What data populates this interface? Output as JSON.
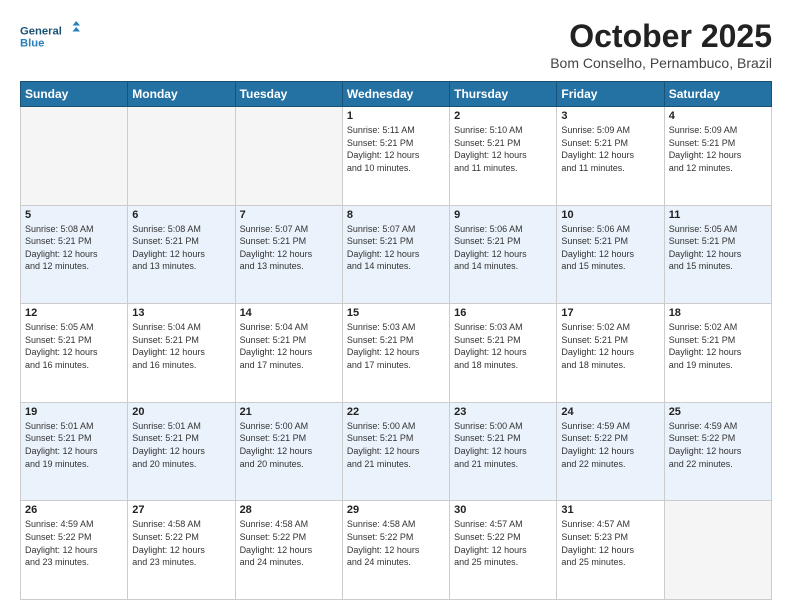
{
  "header": {
    "logo_line1": "General",
    "logo_line2": "Blue",
    "month": "October 2025",
    "location": "Bom Conselho, Pernambuco, Brazil"
  },
  "days_of_week": [
    "Sunday",
    "Monday",
    "Tuesday",
    "Wednesday",
    "Thursday",
    "Friday",
    "Saturday"
  ],
  "weeks": [
    [
      {
        "day": "",
        "empty": true
      },
      {
        "day": "",
        "empty": true
      },
      {
        "day": "",
        "empty": true
      },
      {
        "day": "1",
        "sunrise": "5:11 AM",
        "sunset": "5:21 PM",
        "daylight": "12 hours and 10 minutes."
      },
      {
        "day": "2",
        "sunrise": "5:10 AM",
        "sunset": "5:21 PM",
        "daylight": "12 hours and 11 minutes."
      },
      {
        "day": "3",
        "sunrise": "5:09 AM",
        "sunset": "5:21 PM",
        "daylight": "12 hours and 11 minutes."
      },
      {
        "day": "4",
        "sunrise": "5:09 AM",
        "sunset": "5:21 PM",
        "daylight": "12 hours and 12 minutes."
      }
    ],
    [
      {
        "day": "5",
        "sunrise": "5:08 AM",
        "sunset": "5:21 PM",
        "daylight": "12 hours and 12 minutes."
      },
      {
        "day": "6",
        "sunrise": "5:08 AM",
        "sunset": "5:21 PM",
        "daylight": "12 hours and 13 minutes."
      },
      {
        "day": "7",
        "sunrise": "5:07 AM",
        "sunset": "5:21 PM",
        "daylight": "12 hours and 13 minutes."
      },
      {
        "day": "8",
        "sunrise": "5:07 AM",
        "sunset": "5:21 PM",
        "daylight": "12 hours and 14 minutes."
      },
      {
        "day": "9",
        "sunrise": "5:06 AM",
        "sunset": "5:21 PM",
        "daylight": "12 hours and 14 minutes."
      },
      {
        "day": "10",
        "sunrise": "5:06 AM",
        "sunset": "5:21 PM",
        "daylight": "12 hours and 15 minutes."
      },
      {
        "day": "11",
        "sunrise": "5:05 AM",
        "sunset": "5:21 PM",
        "daylight": "12 hours and 15 minutes."
      }
    ],
    [
      {
        "day": "12",
        "sunrise": "5:05 AM",
        "sunset": "5:21 PM",
        "daylight": "12 hours and 16 minutes."
      },
      {
        "day": "13",
        "sunrise": "5:04 AM",
        "sunset": "5:21 PM",
        "daylight": "12 hours and 16 minutes."
      },
      {
        "day": "14",
        "sunrise": "5:04 AM",
        "sunset": "5:21 PM",
        "daylight": "12 hours and 17 minutes."
      },
      {
        "day": "15",
        "sunrise": "5:03 AM",
        "sunset": "5:21 PM",
        "daylight": "12 hours and 17 minutes."
      },
      {
        "day": "16",
        "sunrise": "5:03 AM",
        "sunset": "5:21 PM",
        "daylight": "12 hours and 18 minutes."
      },
      {
        "day": "17",
        "sunrise": "5:02 AM",
        "sunset": "5:21 PM",
        "daylight": "12 hours and 18 minutes."
      },
      {
        "day": "18",
        "sunrise": "5:02 AM",
        "sunset": "5:21 PM",
        "daylight": "12 hours and 19 minutes."
      }
    ],
    [
      {
        "day": "19",
        "sunrise": "5:01 AM",
        "sunset": "5:21 PM",
        "daylight": "12 hours and 19 minutes."
      },
      {
        "day": "20",
        "sunrise": "5:01 AM",
        "sunset": "5:21 PM",
        "daylight": "12 hours and 20 minutes."
      },
      {
        "day": "21",
        "sunrise": "5:00 AM",
        "sunset": "5:21 PM",
        "daylight": "12 hours and 20 minutes."
      },
      {
        "day": "22",
        "sunrise": "5:00 AM",
        "sunset": "5:21 PM",
        "daylight": "12 hours and 21 minutes."
      },
      {
        "day": "23",
        "sunrise": "5:00 AM",
        "sunset": "5:21 PM",
        "daylight": "12 hours and 21 minutes."
      },
      {
        "day": "24",
        "sunrise": "4:59 AM",
        "sunset": "5:22 PM",
        "daylight": "12 hours and 22 minutes."
      },
      {
        "day": "25",
        "sunrise": "4:59 AM",
        "sunset": "5:22 PM",
        "daylight": "12 hours and 22 minutes."
      }
    ],
    [
      {
        "day": "26",
        "sunrise": "4:59 AM",
        "sunset": "5:22 PM",
        "daylight": "12 hours and 23 minutes."
      },
      {
        "day": "27",
        "sunrise": "4:58 AM",
        "sunset": "5:22 PM",
        "daylight": "12 hours and 23 minutes."
      },
      {
        "day": "28",
        "sunrise": "4:58 AM",
        "sunset": "5:22 PM",
        "daylight": "12 hours and 24 minutes."
      },
      {
        "day": "29",
        "sunrise": "4:58 AM",
        "sunset": "5:22 PM",
        "daylight": "12 hours and 24 minutes."
      },
      {
        "day": "30",
        "sunrise": "4:57 AM",
        "sunset": "5:22 PM",
        "daylight": "12 hours and 25 minutes."
      },
      {
        "day": "31",
        "sunrise": "4:57 AM",
        "sunset": "5:23 PM",
        "daylight": "12 hours and 25 minutes."
      },
      {
        "day": "",
        "empty": true
      }
    ]
  ],
  "labels": {
    "sunrise": "Sunrise:",
    "sunset": "Sunset:",
    "daylight": "Daylight:"
  }
}
